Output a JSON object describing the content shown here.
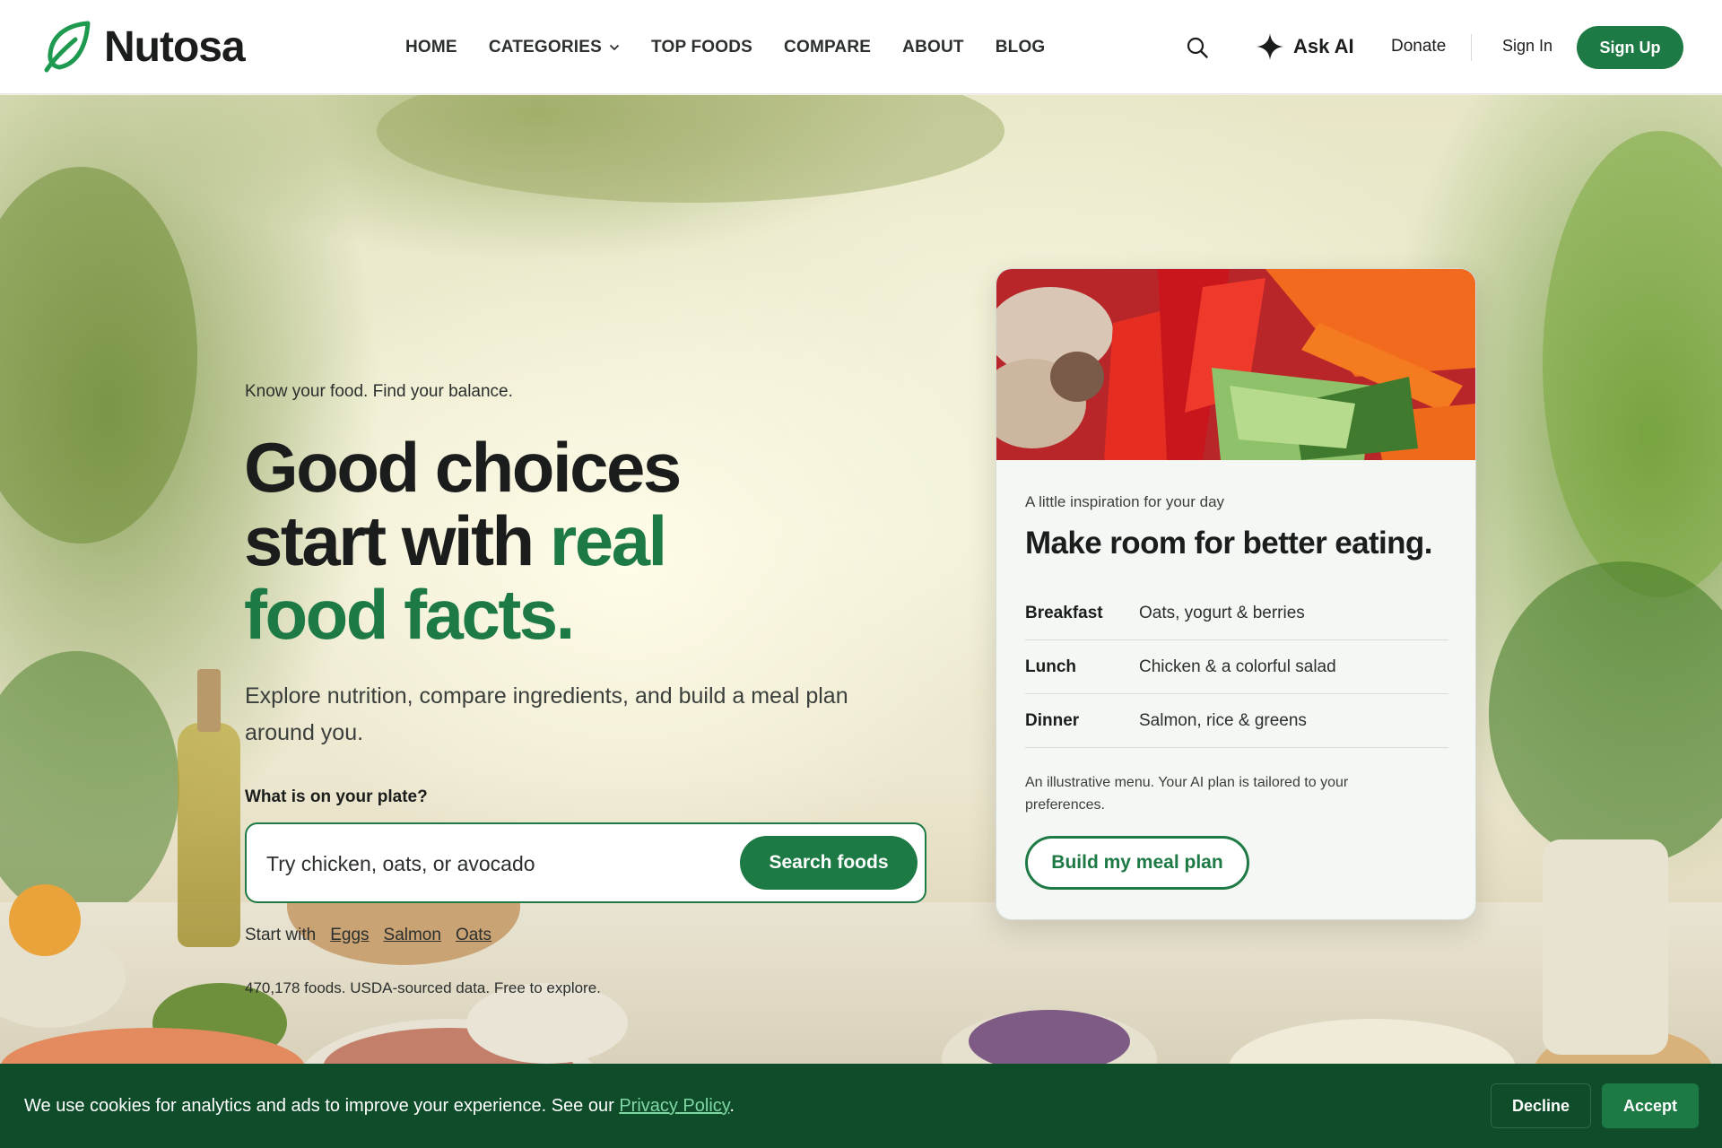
{
  "brand": {
    "name": "Nutosa",
    "accent": "#1d7a45",
    "logo_icon": "leaf-icon"
  },
  "nav": {
    "items": [
      {
        "label": "HOME"
      },
      {
        "label": "CATEGORIES",
        "icon": "chevron-down-icon"
      },
      {
        "label": "TOP FOODS"
      },
      {
        "label": "COMPARE"
      },
      {
        "label": "ABOUT"
      },
      {
        "label": "BLOG"
      }
    ],
    "search_icon": "search-icon",
    "ask_ai_label": "Ask AI",
    "ask_ai_icon": "sparkle-icon",
    "donate_label": "Donate",
    "sign_in_label": "Sign In",
    "sign_up_label": "Sign Up"
  },
  "hero": {
    "tagline": "Know your food. Find your balance.",
    "headline_part1": "Good choices start with ",
    "headline_part2": "real food facts.",
    "subtitle": "Explore nutrition, compare ingredients, and build a meal plan around you.",
    "search": {
      "label": "What is on your plate?",
      "placeholder": "Try chicken, oats, or avocado",
      "value": "",
      "button": "Search foods"
    },
    "quick_start": {
      "label": "Start with",
      "items": [
        "Eggs",
        "Salmon",
        "Oats"
      ]
    },
    "stats_note": "470,178 foods. USDA-sourced data. Free to explore."
  },
  "card": {
    "kicker": "A little inspiration for your day",
    "title": "Make room for better eating.",
    "menu": [
      {
        "meal": "Breakfast",
        "food": "Oats, yogurt & berries"
      },
      {
        "meal": "Lunch",
        "food": "Chicken & a colorful salad"
      },
      {
        "meal": "Dinner",
        "food": "Salmon, rice & greens"
      }
    ],
    "disclaimer": "An illustrative menu. Your AI plan is tailored to your preferences.",
    "button": "Build my meal plan"
  },
  "cookie": {
    "text": "We use cookies for analytics and ads to improve your experience. See our ",
    "link": "Privacy Policy",
    "suffix": ".",
    "decline": "Decline",
    "accept": "Accept"
  }
}
